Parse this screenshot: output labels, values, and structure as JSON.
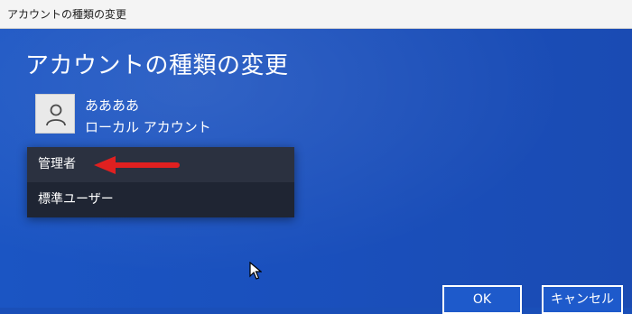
{
  "window": {
    "title": "アカウントの種類の変更"
  },
  "dialog": {
    "heading": "アカウントの種類の変更",
    "user": {
      "name": "ああああ",
      "account_type": "ローカル アカウント",
      "avatar_icon": "user-icon"
    },
    "account_type_dropdown": {
      "options": [
        {
          "label": "管理者",
          "highlighted": true
        },
        {
          "label": "標準ユーザー",
          "highlighted": false
        }
      ]
    },
    "annotation": {
      "arrow_color": "#e02020",
      "arrow_icon": "red-arrow-icon"
    },
    "buttons": {
      "ok_label": "OK",
      "cancel_label": "キャンセル"
    }
  },
  "colors": {
    "dialog_background": "#1a4fb8",
    "dropdown_background": "#242a38",
    "titlebar_background": "#f4f4f4"
  }
}
